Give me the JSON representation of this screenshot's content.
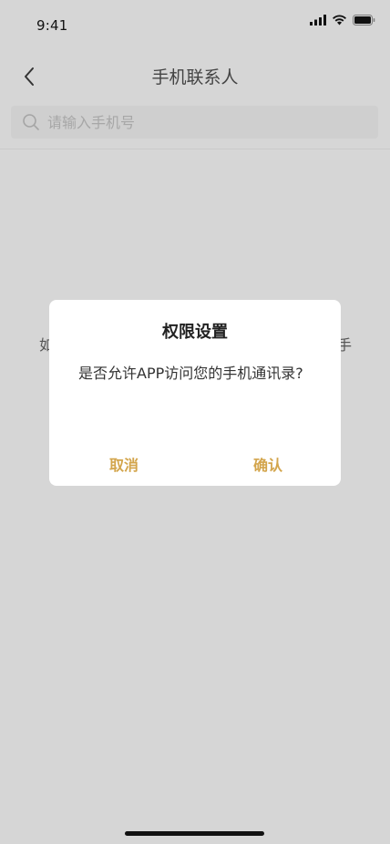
{
  "status_bar": {
    "time": "9:41"
  },
  "nav": {
    "title": "手机联系人"
  },
  "search": {
    "placeholder": "请输入手机号",
    "value": ""
  },
  "background": {
    "text_left": "如",
    "text_right": "手"
  },
  "dialog": {
    "title": "权限设置",
    "message": "是否允许APP访问您的手机通讯录?",
    "cancel_label": "取消",
    "confirm_label": "确认"
  },
  "colors": {
    "accent": "#d3a54c",
    "overlay_bg": "#d6d6d6"
  },
  "icons": {
    "back": "chevron-left-icon",
    "search": "search-icon",
    "signal": "cellular-signal-icon",
    "wifi": "wifi-icon",
    "battery": "battery-icon"
  }
}
